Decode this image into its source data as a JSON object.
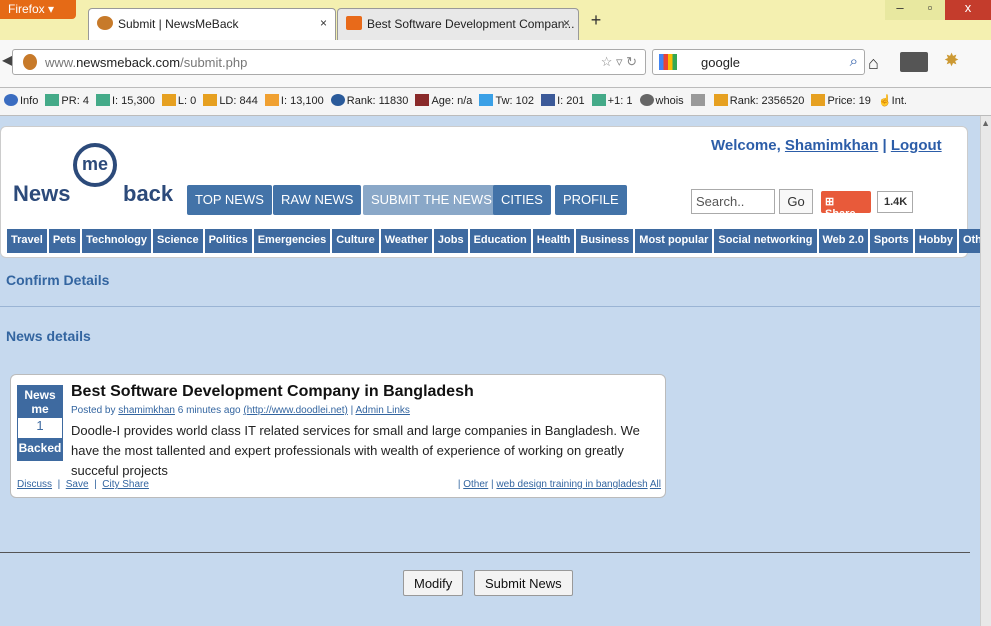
{
  "browser": {
    "firefox_label": "Firefox",
    "tabs": [
      {
        "label": "Submit | NewsMeBack",
        "close": "×"
      },
      {
        "label": "Best Software Development Compan...",
        "close": "×"
      }
    ],
    "new_tab": "+",
    "url_prefix": "www.",
    "url_domain": "newsmeback.com",
    "url_path": "/submit.php",
    "search_value": "google"
  },
  "seo_bar": {
    "items": [
      "Info",
      "PR: 4",
      "I: 15,300",
      "L: 0",
      "LD: 844",
      "I: 13,100",
      "Rank: 11830",
      "Age: n/a",
      "Tw: 102",
      "I: 201",
      "+1: 1",
      "whois",
      "Rank: 2356520",
      "Price: 19",
      "Int."
    ]
  },
  "site": {
    "logo_text_left": "News",
    "logo_circle": "me",
    "logo_text_right": "back",
    "welcome_prefix": "Welcome,",
    "username": "Shamimkhan",
    "logout": "Logout",
    "separator": "|",
    "nav": [
      "TOP NEWS",
      "RAW NEWS",
      "SUBMIT THE NEWS",
      "CITIES",
      "PROFILE"
    ],
    "search_placeholder": "Search..",
    "go_label": "Go",
    "share_label": "Share",
    "share_count": "1.4K",
    "categories": [
      "Travel",
      "Pets",
      "Technology",
      "Science",
      "Politics",
      "Emergencies",
      "Culture",
      "Weather",
      "Jobs",
      "Education",
      "Health",
      "Business",
      "Most popular",
      "Social networking",
      "Web 2.0",
      "Sports",
      "Hobby",
      "Other"
    ]
  },
  "content": {
    "confirm_title": "Confirm Details",
    "news_details_title": "News details",
    "vote_top": "News me",
    "vote_count": "1",
    "vote_button": "Backed",
    "news_title": "Best Software Development Company in Bangladesh",
    "posted_prefix": "Posted by",
    "posted_user": "shamimkhan",
    "posted_time": "6 minutes ago",
    "posted_url": "(http://www.doodlei.net)",
    "admin_links": "Admin Links",
    "description": "Doodle-I provides world class IT related services for small and large companies in Bangladesh. We have the most tallented and expert professionals with wealth of experience of working on greatly succeful projects",
    "discuss": "Discuss",
    "save": "Save",
    "city_share": "City Share",
    "footer_category": "Other",
    "footer_tag": "web design training in bangladesh",
    "footer_all": "All",
    "modify_label": "Modify",
    "submit_label": "Submit News"
  }
}
